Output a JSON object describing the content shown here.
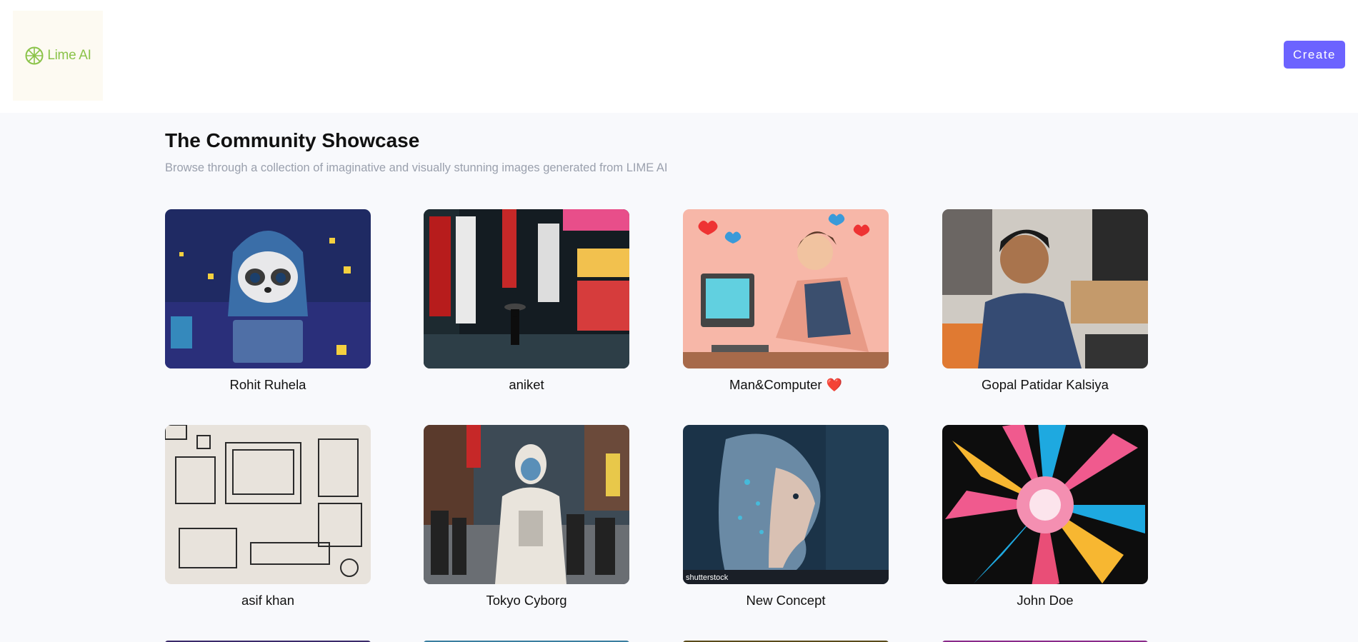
{
  "header": {
    "logo_text": "Lime AI",
    "create_label": "Create"
  },
  "main": {
    "title": "The Community Showcase",
    "subtitle": "Browse through a collection of imaginative and visually stunning images generated from LIME AI"
  },
  "cards": [
    {
      "caption": "Rohit Ruhela",
      "icon": "raccoon-laptop-image"
    },
    {
      "caption": "aniket",
      "icon": "tokyo-street-image"
    },
    {
      "caption": "Man&Computer",
      "icon": "man-computer-image",
      "emoji": "❤️"
    },
    {
      "caption": "Gopal Patidar Kalsiya",
      "icon": "boy-computer-image"
    },
    {
      "caption": "asif khan",
      "icon": "computer-sketch-image"
    },
    {
      "caption": "Tokyo Cyborg",
      "icon": "cyborg-image"
    },
    {
      "caption": "New Concept",
      "icon": "ai-face-image"
    },
    {
      "caption": "John Doe",
      "icon": "color-burst-image"
    }
  ],
  "colors": {
    "accent": "#6c63ff",
    "logo": "#8bc34a",
    "background": "#f8f9fc"
  }
}
